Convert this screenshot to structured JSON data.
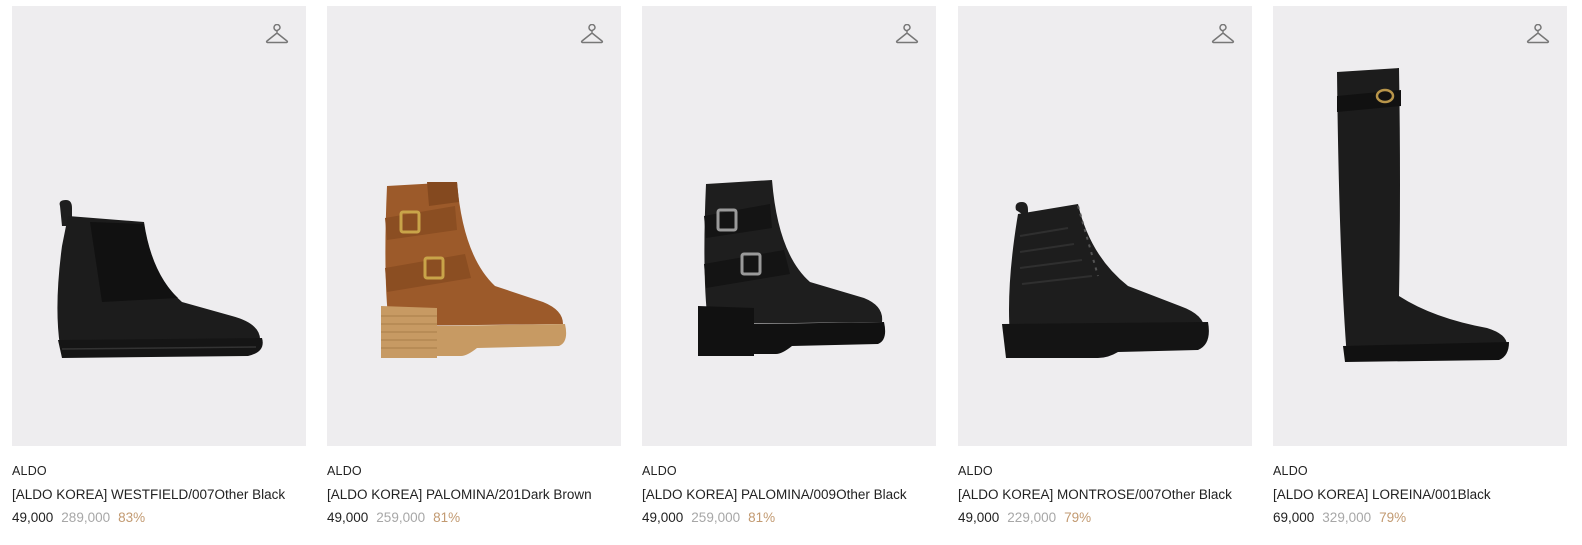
{
  "products": [
    {
      "brand": "ALDO",
      "name": "[ALDO KOREA] WESTFIELD/007Other Black",
      "price": "49,000",
      "original_price": "289,000",
      "discount": "83%"
    },
    {
      "brand": "ALDO",
      "name": "[ALDO KOREA] PALOMINA/201Dark Brown",
      "price": "49,000",
      "original_price": "259,000",
      "discount": "81%"
    },
    {
      "brand": "ALDO",
      "name": "[ALDO KOREA] PALOMINA/009Other Black",
      "price": "49,000",
      "original_price": "259,000",
      "discount": "81%"
    },
    {
      "brand": "ALDO",
      "name": "[ALDO KOREA] MONTROSE/007Other Black",
      "price": "49,000",
      "original_price": "229,000",
      "discount": "79%"
    },
    {
      "brand": "ALDO",
      "name": "[ALDO KOREA] LOREINA/001Black",
      "price": "69,000",
      "original_price": "329,000",
      "discount": "79%"
    }
  ],
  "colors": {
    "image_bg": "#eeedef",
    "discount": "#c29a71",
    "original_price": "#a7a7a7"
  },
  "icons": {
    "wishlist": "hanger-icon"
  }
}
